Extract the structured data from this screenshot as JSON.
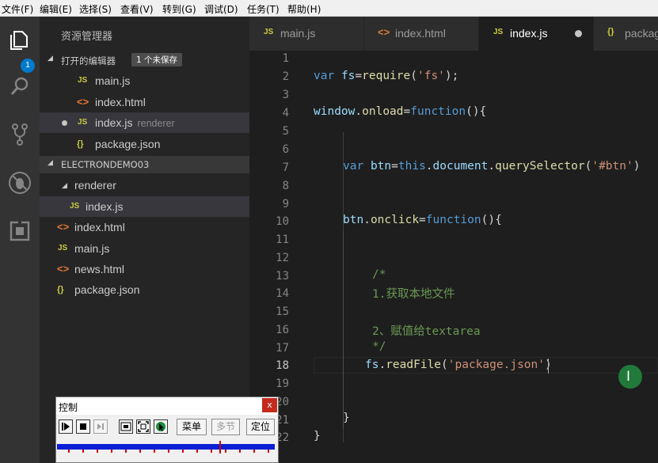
{
  "menu": [
    "文件(F)",
    "编辑(E)",
    "选择(S)",
    "查看(V)",
    "转到(G)",
    "调试(D)",
    "任务(T)",
    "帮助(H)"
  ],
  "activity": {
    "explorer_badge": "1",
    "icons": [
      "files-icon",
      "search-icon",
      "source-control-icon",
      "debug-icon",
      "extensions-icon"
    ]
  },
  "sidebar": {
    "title": "资源管理器",
    "open_editors": {
      "label": "打开的编辑器",
      "badge": "1 个未保存",
      "items": [
        {
          "icon": "JS",
          "name": "main.js",
          "desc": ""
        },
        {
          "icon": "<>",
          "name": "index.html",
          "desc": ""
        },
        {
          "icon": "JS",
          "name": "index.js",
          "desc": "renderer"
        },
        {
          "icon": "{}",
          "name": "package.json",
          "desc": ""
        }
      ]
    },
    "project": {
      "label": "ELECTRONDEMO03",
      "folder": "renderer",
      "folder_items": [
        {
          "icon": "JS",
          "name": "index.js"
        }
      ],
      "items": [
        {
          "icon": "<>",
          "name": "index.html"
        },
        {
          "icon": "JS",
          "name": "main.js"
        },
        {
          "icon": "<>",
          "name": "news.html"
        },
        {
          "icon": "{}",
          "name": "package.json"
        }
      ]
    }
  },
  "tabs": [
    {
      "icon": "JS",
      "name": "main.js"
    },
    {
      "icon": "<>",
      "name": "index.html"
    },
    {
      "icon": "JS",
      "name": "index.js"
    },
    {
      "icon": "{}",
      "name": "package.json"
    }
  ],
  "editor": {
    "current_line": 18,
    "line_numbers": [
      "1",
      "2",
      "3",
      "4",
      "5",
      "6",
      "7",
      "8",
      "9",
      "10",
      "11",
      "12",
      "13",
      "14",
      "15",
      "16",
      "17",
      "18",
      "19",
      "20",
      "21",
      "22"
    ],
    "code": {
      "l2": [
        "var",
        "fs",
        "=",
        "require",
        "(",
        "'fs'",
        ");"
      ],
      "l4": [
        "window",
        ".",
        "onload",
        "=",
        "function",
        "(){"
      ],
      "l7": [
        "var",
        "btn",
        "=",
        "this",
        ".",
        "document",
        ".",
        "querySelector",
        "(",
        "'#btn'",
        ")"
      ],
      "l10": [
        "btn",
        ".",
        "onclick",
        "=",
        "function",
        "(){"
      ],
      "l13": "/*",
      "l14": "1.获取本地文件",
      "l16": "2、赋值给textarea",
      "l17": "*/",
      "l18": [
        "fs",
        ".",
        "readFile",
        "(",
        "'package.json'",
        ")"
      ],
      "l21": "}",
      "l22": "}"
    }
  },
  "control_window": {
    "title": "控制",
    "close": "x",
    "buttons": {
      "menu": "菜单",
      "multi": "多节",
      "locate": "定位"
    }
  },
  "colors": {
    "accent": "#007acc",
    "keyword": "#569cd6",
    "string": "#ce9178",
    "comment": "#6a9955",
    "function": "#dcdcaa",
    "identifier": "#9cdcfe"
  }
}
